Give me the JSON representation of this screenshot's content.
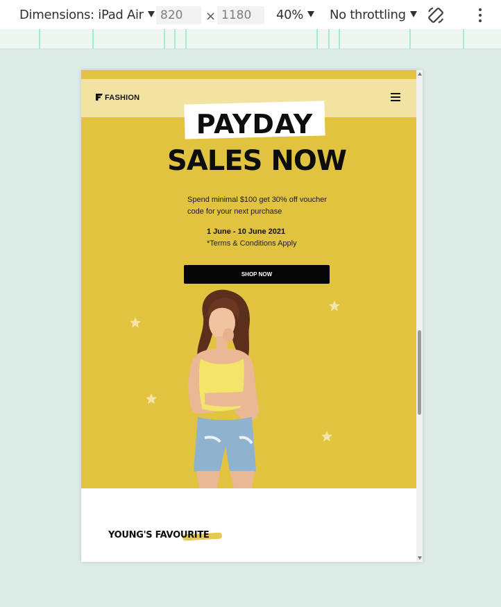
{
  "devtools": {
    "device_label": "Dimensions: iPad Air",
    "width_value": "820",
    "height_value": "1180",
    "times_symbol": "×",
    "zoom_label": "40%",
    "throttling_label": "No throttling",
    "rotate_icon": "rotate-icon",
    "more_icon": "kebab-menu-icon"
  },
  "site": {
    "logo_text": "FASHION",
    "menu_icon": "hamburger-icon",
    "hero": {
      "headline_1": "PAYDAY",
      "headline_2": "SALES NOW",
      "description": "Spend minimal $100 get 30% off voucher code for your next purchase",
      "dates": "1 June - 10 June 2021",
      "terms": "*Terms & Conditions Apply",
      "cta_label": "SHOP NOW"
    },
    "section_title": "YOUNG'S FAVOURITE"
  },
  "colors": {
    "hero_yellow": "#e1c33f",
    "nav_cream": "#f3e3a3",
    "button_black": "#050505",
    "page_bg": "#dcebe5"
  }
}
